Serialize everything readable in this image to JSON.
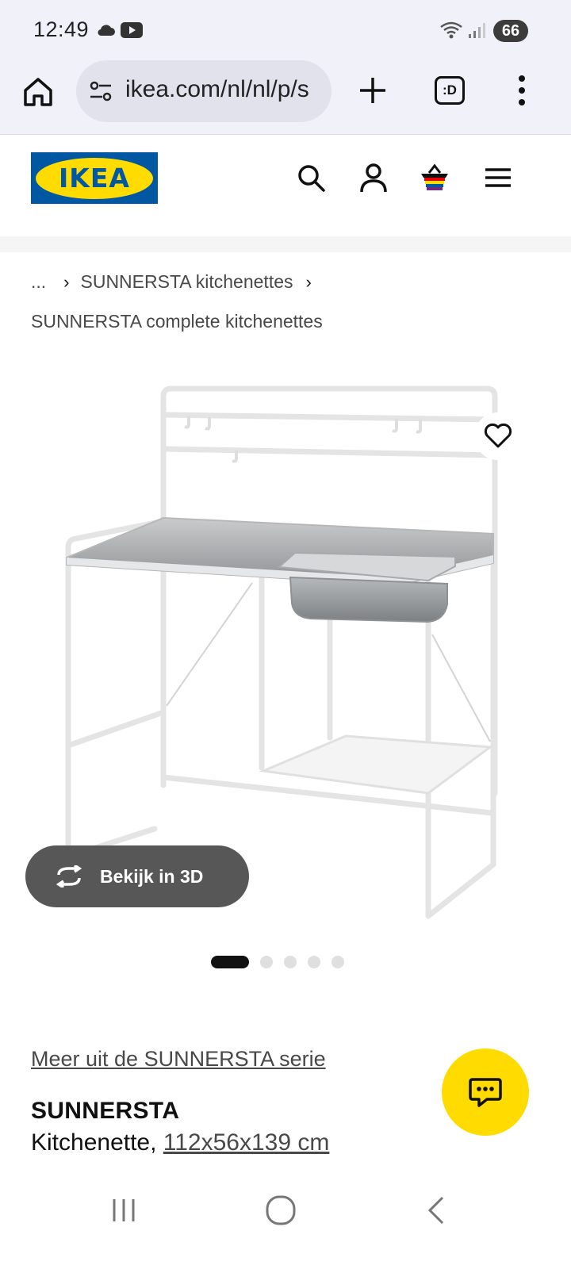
{
  "status_bar": {
    "time": "12:49",
    "battery": "66",
    "left_icons": [
      "cloud-icon",
      "youtube-icon"
    ],
    "right_icons": [
      "wifi-icon",
      "signal-icon",
      "battery-icon"
    ]
  },
  "browser": {
    "url": "ikea.com/nl/nl/p/s",
    "tabs_label": ":D"
  },
  "header": {
    "logo_text": "IKEA",
    "icons": [
      "search-icon",
      "account-icon",
      "basket-icon",
      "hamburger-menu-icon"
    ]
  },
  "breadcrumb": {
    "ellipsis": "...",
    "separator": "›",
    "parent": "SUNNERSTA kitchenettes",
    "current": "SUNNERSTA complete kitchenettes"
  },
  "gallery": {
    "view_3d_label": "Bekijk in 3D",
    "dots_total": 5,
    "active_dot": 1
  },
  "product": {
    "series_link": "Meer uit de SUNNERSTA serie",
    "name": "SUNNERSTA",
    "type": "Kitchenette, ",
    "dimensions": "112x56x139 cm"
  },
  "colors": {
    "ikea_blue": "#0058a3",
    "ikea_yellow": "#ffdb00",
    "chrome_bg": "#f1f1f9"
  }
}
